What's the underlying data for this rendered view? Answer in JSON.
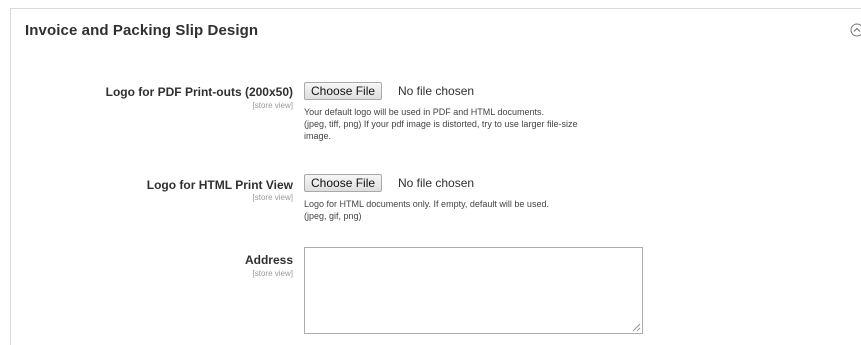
{
  "section": {
    "title": "Invoice and Packing Slip Design",
    "collapse_icon": "chevron-up-circle-icon"
  },
  "fields": {
    "logo_pdf": {
      "label": "Logo for PDF Print-outs (200x50)",
      "scope": "[store view]",
      "button": "Choose File",
      "status": "No file chosen",
      "note_lines": [
        "Your default logo will be used in PDF and HTML documents.",
        "(jpeg, tiff, png) If your pdf image is distorted, try to use larger file-size",
        "image."
      ]
    },
    "logo_html": {
      "label": "Logo for HTML Print View",
      "scope": "[store view]",
      "button": "Choose File",
      "status": "No file chosen",
      "note_lines": [
        "Logo for HTML documents only. If empty, default will be used.",
        "(jpeg, gif, png)"
      ]
    },
    "address": {
      "label": "Address",
      "scope": "[store view]",
      "value": ""
    }
  }
}
